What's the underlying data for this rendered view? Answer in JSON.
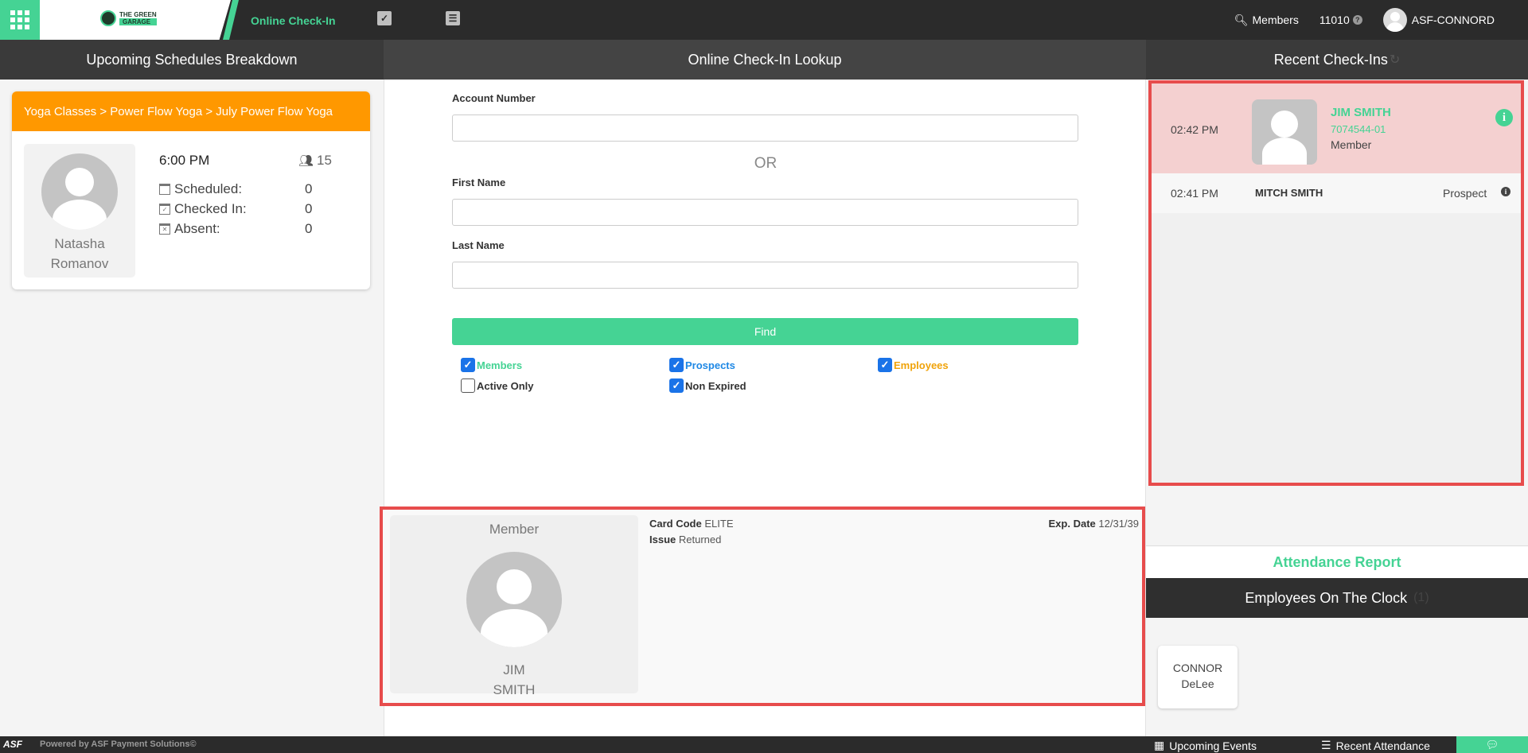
{
  "topbar": {
    "nav_active": "Online Check-In",
    "members_label": "Members",
    "code": "11010",
    "user": "ASF-CONNORD",
    "logo_line1": "THE GREEN",
    "logo_line2": "GARAGE"
  },
  "headers": {
    "left": "Upcoming Schedules Breakdown",
    "middle": "Online Check-In Lookup",
    "right": "Recent Check-Ins"
  },
  "schedule": {
    "title": "Yoga Classes > Power Flow Yoga > July Power Flow Yoga",
    "time": "6:00 PM",
    "capacity": "15",
    "instructor_first": "Natasha",
    "instructor_last": "Romanov",
    "scheduled_label": "Scheduled:",
    "scheduled_value": "0",
    "checked_in_label": "Checked In:",
    "checked_in_value": "0",
    "absent_label": "Absent:",
    "absent_value": "0"
  },
  "lookup": {
    "account_label": "Account Number",
    "account_value": "",
    "or_text": "OR",
    "first_label": "First Name",
    "first_value": "",
    "last_label": "Last Name",
    "last_value": "",
    "find_label": "Find",
    "filters": {
      "members": "Members",
      "prospects": "Prospects",
      "employees": "Employees",
      "active_only": "Active Only",
      "non_expired": "Non Expired"
    }
  },
  "result": {
    "type": "Member",
    "first": "JIM",
    "last": "SMITH",
    "card_code_label": "Card Code",
    "card_code": "ELITE",
    "issue_label": "Issue",
    "issue": "Returned",
    "exp_label": "Exp. Date",
    "exp": "12/31/39"
  },
  "recent": [
    {
      "time": "02:42 PM",
      "name": "JIM SMITH",
      "id": "7074544-01",
      "type": "Member"
    },
    {
      "time": "02:41 PM",
      "name": "MITCH SMITH",
      "type": "Prospect"
    }
  ],
  "attendance_report": "Attendance Report",
  "employees_header": "Employees On The Clock",
  "employees_count": "(1)",
  "employee": {
    "first": "CONNOR",
    "last": "DeLee"
  },
  "footer": {
    "brand": "ASF",
    "powered": "Powered by ASF Payment Solutions©",
    "upcoming": "Upcoming Events",
    "recent_attendance": "Recent Attendance"
  },
  "colors": {
    "accent": "#45d394",
    "orange": "#ff9800",
    "prospect_blue": "#1e88e5",
    "employee_gold": "#f0a30a",
    "highlight_red": "#e74c4c"
  }
}
